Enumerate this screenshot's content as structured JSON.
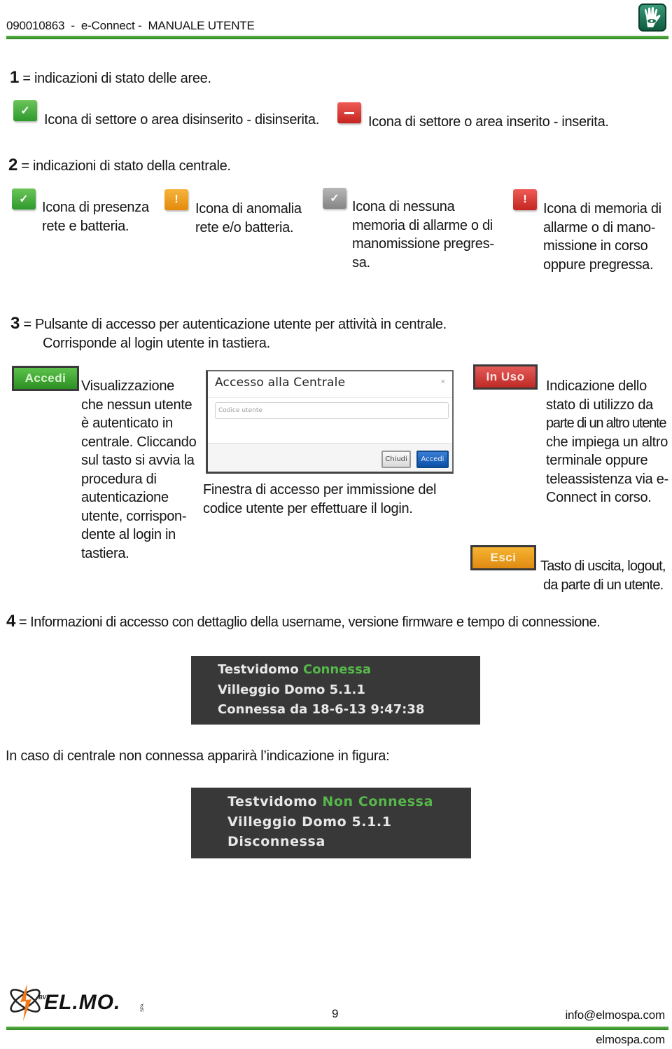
{
  "header": {
    "title": "090010863  -  e-Connect -  MANUALE UTENTE",
    "logo_icon": "hand-eye-icon",
    "rule_color": "#3a9a2c"
  },
  "section1": {
    "number": "1",
    "heading": "= indicazioni di stato delle aree.",
    "items": [
      {
        "icon": "green-check-icon",
        "text": "Icona di settore o area disinserito - disinserita."
      },
      {
        "icon": "red-minus-icon",
        "text": "Icona di settore o area inserito - inserita."
      }
    ]
  },
  "section2": {
    "number": "2",
    "heading": "= indicazioni di stato della centrale.",
    "items": [
      {
        "icon": "green-check-icon",
        "lines": [
          "Icona di presenza",
          "rete e batteria."
        ]
      },
      {
        "icon": "orange-exclamation-icon",
        "lines": [
          "Icona di anomalia",
          "rete e/o batteria."
        ]
      },
      {
        "icon": "grey-check-icon",
        "lines": [
          "Icona di nessuna",
          "memoria di allarme o di",
          "manomissione pregres-",
          "sa."
        ]
      },
      {
        "icon": "red-exclamation-icon",
        "lines": [
          "Icona di memoria di",
          "allarme o di mano-",
          "missione in corso",
          "oppure pregressa."
        ]
      }
    ]
  },
  "section3": {
    "number": "3",
    "heading_lines": [
      "= Pulsante di accesso per autenticazione utente per attività in centrale.",
      "Corrisponde al login utente in tastiera."
    ],
    "accedi_button": "Accedi",
    "accedi_desc": [
      "Visualizzazione",
      "che nessun utente",
      "è autenticato in",
      "centrale. Cliccando",
      "sul tasto si avvia la",
      "procedura di",
      "autenticazione",
      "utente, corrispon-",
      "dente al login in",
      "tastiera."
    ],
    "dialog": {
      "title": "Accesso alla Centrale",
      "close_glyph": "×",
      "input_placeholder": "Codice utente",
      "cancel_label": "Chiudi",
      "confirm_label": "Accedi"
    },
    "dialog_caption": [
      "Finestra di accesso per immissione del",
      "codice utente per effettuare il login."
    ],
    "inuso_button": "In Uso",
    "inuso_desc": [
      "Indicazione dello",
      "stato di utilizzo da",
      "parte di un altro utente",
      "che impiega un altro",
      "terminale oppure",
      "teleassistenza via e-",
      "Connect in corso."
    ],
    "esci_button": "Esci",
    "esci_desc": [
      "Tasto di uscita, logout,",
      "da parte  di un utente."
    ]
  },
  "section4": {
    "number": "4",
    "heading": "= Informazioni di accesso con dettaglio della username, versione firmware e tempo di connessione.",
    "panel_connected": {
      "user": "Testvidomo",
      "status": "Connessa",
      "firmware": "Villeggio Domo 5.1.1",
      "since": "Connessa da 18-6-13 9:47:38"
    },
    "not_connected_intro": "In caso di centrale non connessa apparirà l’indicazione in figura:",
    "panel_disconnected": {
      "user": "Testvidomo",
      "status": "Non Connessa",
      "firmware": "Villeggio Domo 5.1.1",
      "since": "Disconnessa"
    },
    "status_color": "#56b84a"
  },
  "footer": {
    "logo_text": "EL.MO.",
    "logo_small": "SPA",
    "logo_prefix": "BV",
    "page_number": "9",
    "email": "info@elmospa.com",
    "website": "elmospa.com"
  }
}
